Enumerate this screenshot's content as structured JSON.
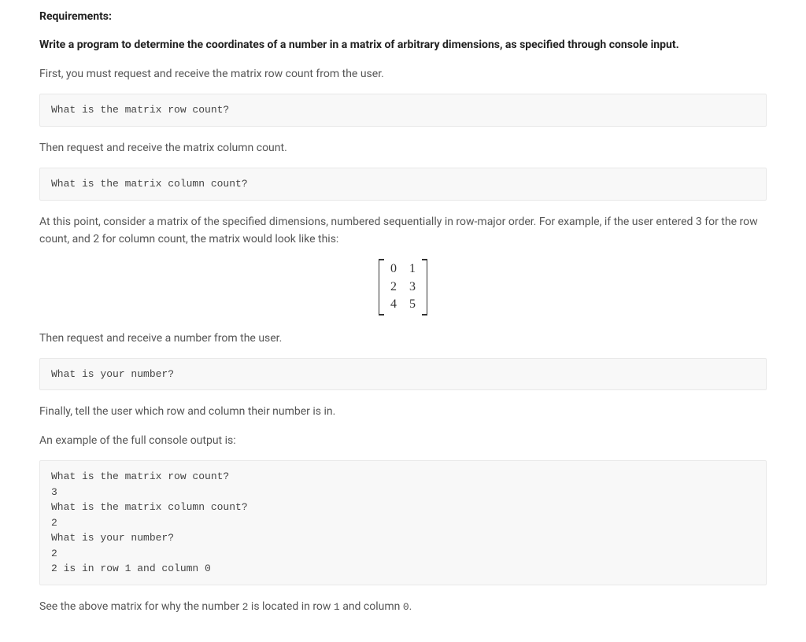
{
  "heading": "Requirements:",
  "intro": "Write a program to determine the coordinates of a number in a matrix of arbitrary dimensions, as specified through console input.",
  "p1": "First, you must request and receive the matrix row count from the user.",
  "code1": "What is the matrix row count?",
  "p2": "Then request and receive the matrix column count.",
  "code2": "What is the matrix column count?",
  "p3": "At this point, consider a matrix of the specified dimensions, numbered sequentially in row-major order. For example, if the user entered 3 for the row count, and 2 for column count, the matrix would look like this:",
  "matrix": [
    [
      "0",
      "1"
    ],
    [
      "2",
      "3"
    ],
    [
      "4",
      "5"
    ]
  ],
  "p4": "Then request and receive a number from the user.",
  "code3": "What is your number?",
  "p5": "Finally, tell the user which row and column their number is in.",
  "p6": "An example of the full console output is:",
  "code4": "What is the matrix row count?\n3\nWhat is the matrix column count?\n2\nWhat is your number?\n2\n2 is in row 1 and column 0",
  "closing_prefix": "See the above matrix for why the number ",
  "closing_num": "2",
  "closing_mid1": " is located in row ",
  "closing_row": "1",
  "closing_mid2": " and column ",
  "closing_col": "0",
  "closing_suffix": "."
}
